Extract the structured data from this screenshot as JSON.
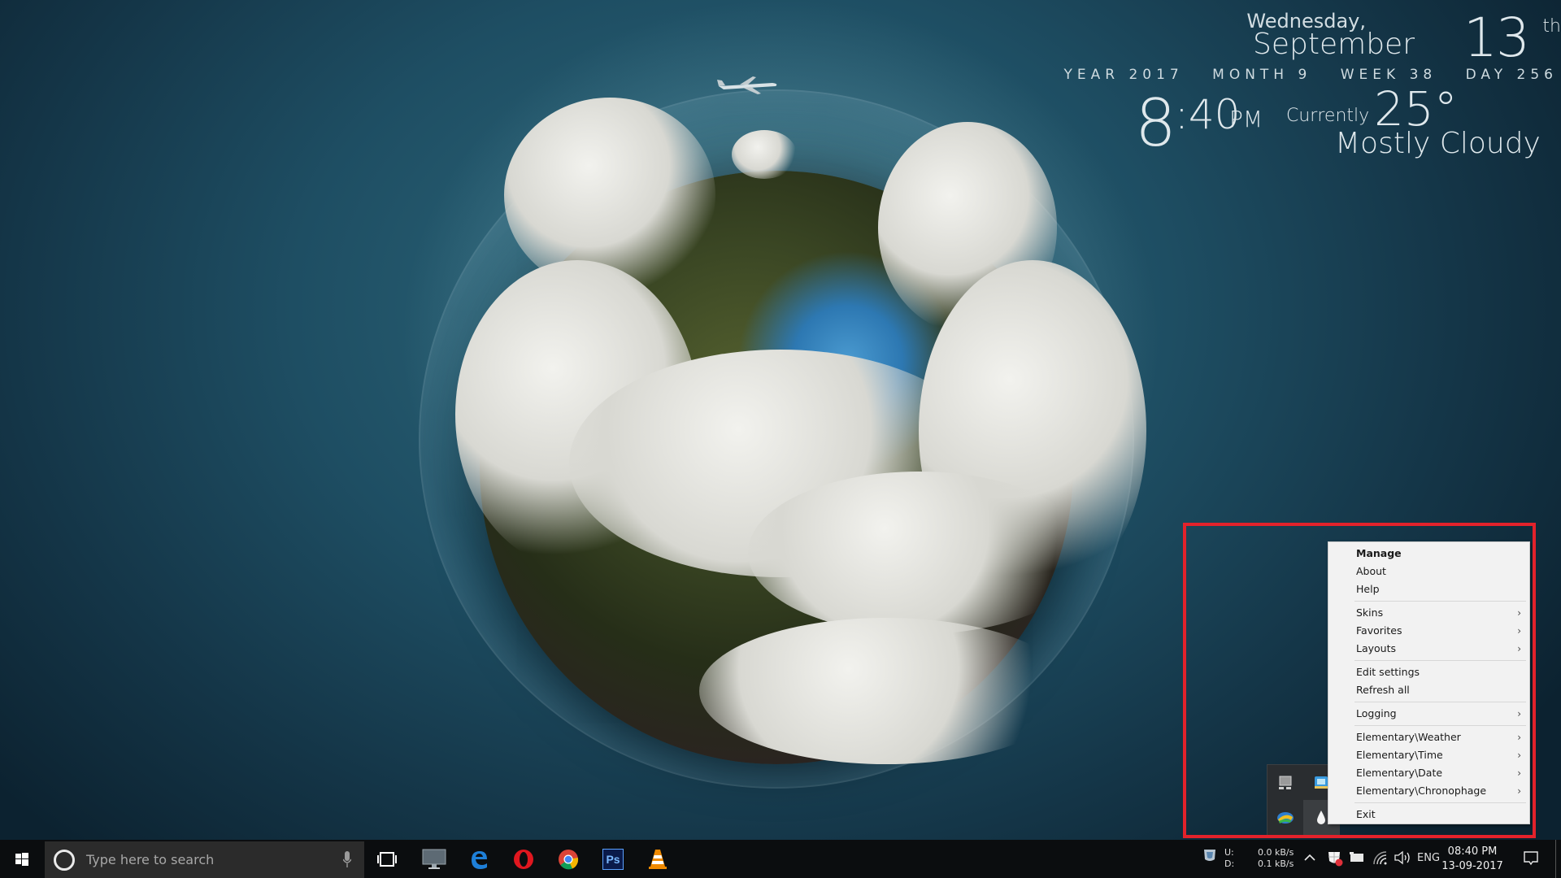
{
  "widgets": {
    "date": {
      "weekday": "Wednesday,",
      "month": "September",
      "day": "13",
      "suffix": "th"
    },
    "stats": [
      {
        "label": "YEAR",
        "value": "2017"
      },
      {
        "label": "MONTH",
        "value": "9"
      },
      {
        "label": "WEEK",
        "value": "38"
      },
      {
        "label": "DAY",
        "value": "256"
      }
    ],
    "time": {
      "hour": "8",
      "minutes": ":40",
      "ampm": "PM"
    },
    "weather": {
      "label": "Currently",
      "temperature": "25°",
      "condition": "Mostly Cloudy"
    }
  },
  "context_menu": {
    "groups": [
      [
        {
          "label": "Manage",
          "bold": true,
          "submenu": false
        },
        {
          "label": "About",
          "submenu": false
        },
        {
          "label": "Help",
          "submenu": false
        }
      ],
      [
        {
          "label": "Skins",
          "submenu": true
        },
        {
          "label": "Favorites",
          "submenu": true
        },
        {
          "label": "Layouts",
          "submenu": true
        }
      ],
      [
        {
          "label": "Edit settings",
          "submenu": false
        },
        {
          "label": "Refresh all",
          "submenu": false
        }
      ],
      [
        {
          "label": "Logging",
          "submenu": true
        }
      ],
      [
        {
          "label": "Elementary\\Weather",
          "submenu": true
        },
        {
          "label": "Elementary\\Time",
          "submenu": true
        },
        {
          "label": "Elementary\\Date",
          "submenu": true
        },
        {
          "label": "Elementary\\Chronophage",
          "submenu": true
        }
      ],
      [
        {
          "label": "Exit",
          "submenu": false
        }
      ]
    ],
    "chevron": "›"
  },
  "tray_overflow": {
    "icons": [
      "network-drive-icon",
      "network-monitor-icon",
      "download-manager-icon",
      "rainmeter-icon"
    ]
  },
  "taskbar": {
    "search_placeholder": "Type here to search",
    "pinned": [
      "task-view",
      "this-pc",
      "edge",
      "opera",
      "chrome",
      "photoshop",
      "vlc"
    ],
    "photoshop_label": "Ps",
    "network_speed": {
      "up_label": "U:",
      "down_label": "D:",
      "up_value": "0.0 kB/s",
      "down_value": "0.1 kB/s"
    },
    "language": "ENG",
    "clock": {
      "time": "08:40 PM",
      "date": "13-09-2017"
    }
  },
  "colors": {
    "highlight": "#e3222b",
    "menu_bg": "#f2f2f2",
    "taskbar_bg": "#0b0d0f"
  }
}
